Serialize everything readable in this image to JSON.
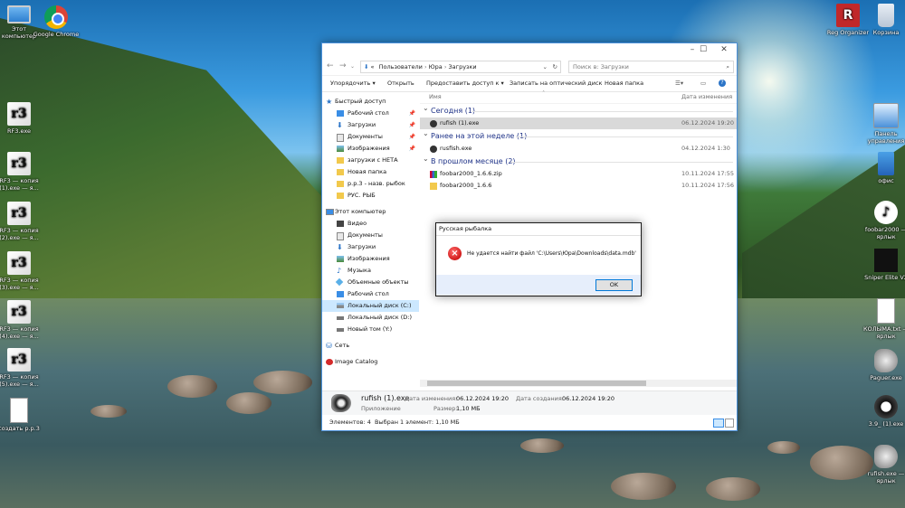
{
  "desktop": {
    "icons_left": [
      {
        "label": "Этот компьютер",
        "icon": "this-pc-icon"
      },
      {
        "label": "Google Chrome",
        "icon": "chrome-icon"
      },
      {
        "label": "RF3.exe",
        "icon": "rf3-icon"
      },
      {
        "label": "RF3 — копия (1).exe — я...",
        "icon": "rf3-icon"
      },
      {
        "label": "RF3 — копия (2).exe — я...",
        "icon": "rf3-icon"
      },
      {
        "label": "RF3 — копия (3).exe — я...",
        "icon": "rf3-icon"
      },
      {
        "label": "RF3 — копия (4).exe — я...",
        "icon": "rf3-icon"
      },
      {
        "label": "RF3 — копия (5).exe — я...",
        "icon": "rf3-icon"
      },
      {
        "label": "создать р.р.3",
        "icon": "document-icon"
      }
    ],
    "icons_right": [
      {
        "label": "Reg Organizer",
        "icon": "reg-organizer-icon"
      },
      {
        "label": "Корзина",
        "icon": "recycle-bin-icon"
      },
      {
        "label": "Панель управления",
        "icon": "control-panel-icon"
      },
      {
        "label": "офис",
        "icon": "office-icon"
      },
      {
        "label": "foobar2000 — ярлык",
        "icon": "foobar-icon"
      },
      {
        "label": "Sniper Elite V2",
        "icon": "sniper-elite-icon"
      },
      {
        "label": "КОЛЫМА.txt — ярлык",
        "icon": "text-file-icon"
      },
      {
        "label": "Paguer.exe",
        "icon": "fish-icon"
      },
      {
        "label": "3.9_ (1).exe",
        "icon": "clock-icon"
      },
      {
        "label": "rufish.exe — ярлык",
        "icon": "fish-icon"
      }
    ]
  },
  "explorer": {
    "address": {
      "prefix": "«",
      "path": [
        "Пользователи",
        "Юра",
        "Загрузки"
      ]
    },
    "search_placeholder": "Поиск в: Загрузки",
    "toolbar": {
      "organize": "Упорядочить ▾",
      "open": "Открыть",
      "share": "Предоставить доступ к ▾",
      "burn": "Записать на оптический диск",
      "new_folder": "Новая папка"
    },
    "nav": {
      "quick_access": "Быстрый доступ",
      "quick_items": [
        {
          "label": "Рабочий стол",
          "pinned": true,
          "icon": "desktop-folder-icon"
        },
        {
          "label": "Загрузки",
          "pinned": true,
          "icon": "downloads-icon"
        },
        {
          "label": "Документы",
          "pinned": true,
          "icon": "documents-icon"
        },
        {
          "label": "Изображения",
          "pinned": true,
          "icon": "pictures-icon"
        },
        {
          "label": "загрузки с НЕТА",
          "pinned": false,
          "icon": "folder-icon"
        },
        {
          "label": "Новая папка",
          "pinned": false,
          "icon": "folder-icon"
        },
        {
          "label": "р.р.3 - назв. рыбок",
          "pinned": false,
          "icon": "folder-icon"
        },
        {
          "label": "РУС. РЫБ",
          "pinned": false,
          "icon": "folder-icon"
        }
      ],
      "this_pc": "Этот компьютер",
      "pc_items": [
        {
          "label": "Видео",
          "icon": "video-icon"
        },
        {
          "label": "Документы",
          "icon": "documents-icon"
        },
        {
          "label": "Загрузки",
          "icon": "downloads-icon"
        },
        {
          "label": "Изображения",
          "icon": "pictures-icon"
        },
        {
          "label": "Музыка",
          "icon": "music-icon"
        },
        {
          "label": "Объемные объекты",
          "icon": "3d-objects-icon"
        },
        {
          "label": "Рабочий стол",
          "icon": "desktop-folder-icon"
        },
        {
          "label": "Локальный диск (C:)",
          "icon": "drive-icon",
          "selected": true
        },
        {
          "label": "Локальный диск (D:)",
          "icon": "drive-icon"
        },
        {
          "label": "Новый том (Y:)",
          "icon": "drive-icon"
        }
      ],
      "network": "Сеть",
      "image_catalog": "Image Catalog"
    },
    "columns": {
      "name": "Имя",
      "date": "Дата изменения"
    },
    "groups": [
      {
        "title": "Сегодня (1)",
        "files": [
          {
            "name": "rufish (1).exe",
            "date": "06.12.2024 19:20",
            "selected": true,
            "icon": "fish-exe-icon"
          }
        ]
      },
      {
        "title": "Ранее на этой неделе (1)",
        "files": [
          {
            "name": "rusfish.exe",
            "date": "04.12.2024 1:30",
            "selected": false,
            "icon": "fish-exe-icon"
          }
        ]
      },
      {
        "title": "В прошлом месяце (2)",
        "files": [
          {
            "name": "foobar2000_1.6.6.zip",
            "date": "10.11.2024 17:55",
            "selected": false,
            "icon": "archive-icon"
          },
          {
            "name": "foobar2000_1.6.6",
            "date": "10.11.2024 17:56",
            "selected": false,
            "icon": "folder-icon"
          }
        ]
      }
    ],
    "details": {
      "name": "rufish (1).exe",
      "type": "Приложение",
      "modified_label": "Дата изменения:",
      "modified_value": "06.12.2024 19:20",
      "size_label": "Размер:",
      "size_value": "1,10 МБ",
      "created_label": "Дата создания:",
      "created_value": "06.12.2024 19:20"
    },
    "status": {
      "items": "Элементов: 4",
      "selected": "Выбран 1 элемент: 1,10 МБ"
    }
  },
  "dialog": {
    "title": "Русская рыбалка",
    "message": "Не удается найти файл 'C:\\Users\\Юра\\Downloads\\data.mdb'",
    "ok": "OK"
  }
}
